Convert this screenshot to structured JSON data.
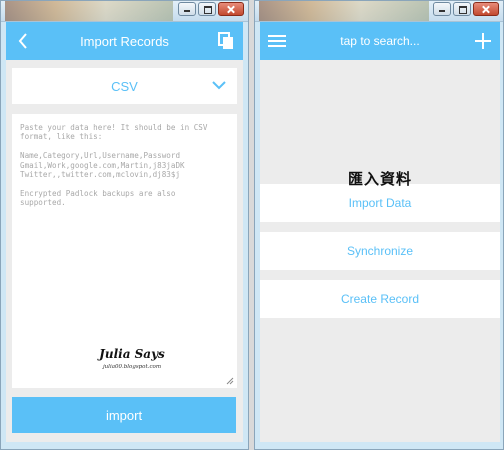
{
  "left_window": {
    "appbar": {
      "title": "Import Records",
      "back_icon": "chevron-left-icon",
      "copy_icon": "copy-icon"
    },
    "format_select": {
      "value": "CSV",
      "icon": "chevron-down-icon"
    },
    "textarea": {
      "placeholder_lines": [
        "Paste your data here! It should be in CSV",
        "format, like this:",
        "",
        "Name,Category,Url,Username,Password",
        "Gmail,Work,google.com,Martin,j83jaDK",
        "Twitter,,twitter.com,mclovin,dj83$j",
        "",
        "Encrypted Padlock backups are also",
        "supported."
      ]
    },
    "watermark": {
      "name": "Julia Says",
      "url": "julia00.blogspot.com"
    },
    "import_button": {
      "label": "import"
    }
  },
  "right_window": {
    "appbar": {
      "menu_icon": "hamburger-menu-icon",
      "search_text": "tap to search...",
      "add_icon": "plus-icon"
    },
    "overlay_caption": "匯入資料",
    "menu": [
      {
        "label": "Import Data"
      },
      {
        "label": "Synchronize"
      },
      {
        "label": "Create Record"
      }
    ]
  },
  "colors": {
    "accent": "#5ac0f7",
    "background": "#ececec",
    "placeholder": "#a8a8a8"
  }
}
